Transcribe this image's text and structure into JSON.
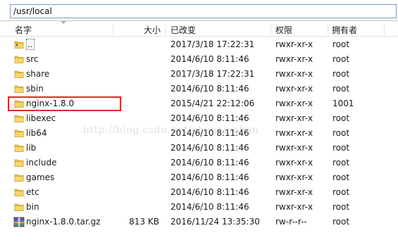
{
  "path": "/usr/local",
  "columns": {
    "name": "名字",
    "size": "大小",
    "modified": "已改变",
    "permissions": "权限",
    "owner": "拥有者"
  },
  "files": [
    {
      "name": "..",
      "size": "",
      "modified": "2017/3/18 17:22:31",
      "permissions": "rwxr-xr-x",
      "owner": "root",
      "icon": "parent-folder-icon"
    },
    {
      "name": "src",
      "size": "",
      "modified": "2014/6/10 8:11:46",
      "permissions": "rwxr-xr-x",
      "owner": "root",
      "icon": "folder-icon"
    },
    {
      "name": "share",
      "size": "",
      "modified": "2017/3/18 17:22:31",
      "permissions": "rwxr-xr-x",
      "owner": "root",
      "icon": "folder-icon"
    },
    {
      "name": "sbin",
      "size": "",
      "modified": "2014/6/10 8:11:46",
      "permissions": "rwxr-xr-x",
      "owner": "root",
      "icon": "folder-icon"
    },
    {
      "name": "nginx-1.8.0",
      "size": "",
      "modified": "2015/4/21 22:12:06",
      "permissions": "rwxr-xr-x",
      "owner": "1001",
      "icon": "folder-icon",
      "highlighted": true
    },
    {
      "name": "libexec",
      "size": "",
      "modified": "2014/6/10 8:11:46",
      "permissions": "rwxr-xr-x",
      "owner": "root",
      "icon": "folder-icon"
    },
    {
      "name": "lib64",
      "size": "",
      "modified": "2014/6/10 8:11:46",
      "permissions": "rwxr-xr-x",
      "owner": "root",
      "icon": "folder-icon"
    },
    {
      "name": "lib",
      "size": "",
      "modified": "2014/6/10 8:11:46",
      "permissions": "rwxr-xr-x",
      "owner": "root",
      "icon": "folder-icon"
    },
    {
      "name": "include",
      "size": "",
      "modified": "2014/6/10 8:11:46",
      "permissions": "rwxr-xr-x",
      "owner": "root",
      "icon": "folder-icon"
    },
    {
      "name": "games",
      "size": "",
      "modified": "2014/6/10 8:11:46",
      "permissions": "rwxr-xr-x",
      "owner": "root",
      "icon": "folder-icon"
    },
    {
      "name": "etc",
      "size": "",
      "modified": "2014/6/10 8:11:46",
      "permissions": "rwxr-xr-x",
      "owner": "root",
      "icon": "folder-icon"
    },
    {
      "name": "bin",
      "size": "",
      "modified": "2014/6/10 8:11:46",
      "permissions": "rwxr-xr-x",
      "owner": "root",
      "icon": "folder-icon"
    },
    {
      "name": "nginx-1.8.0.tar.gz",
      "size": "813 KB",
      "modified": "2016/11/24 13:35:30",
      "permissions": "rw-r--r--",
      "owner": "root",
      "icon": "archive-file-icon"
    }
  ],
  "watermark": "http://blog.csdn.net/chenxiaohan",
  "colors": {
    "folder": "#f2c34a",
    "highlight_border": "#e02828",
    "path_border": "#7a98b8"
  }
}
